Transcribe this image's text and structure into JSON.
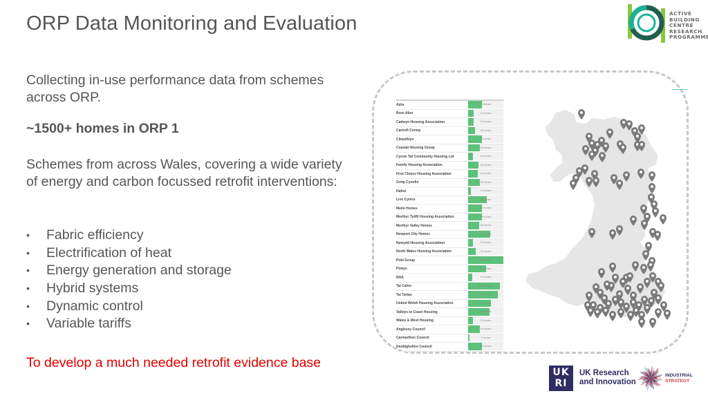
{
  "slide": {
    "title": "ORP Data Monitoring and Evaluation",
    "intro": "Collecting in-use performance data from schemes across ORP.",
    "highlight": "~1500+ homes in ORP 1",
    "schemes_text": "Schemes from across Wales, covering a wide variety of energy and carbon focussed retrofit interventions:",
    "bullet_glyph": "•",
    "interventions": [
      "Fabric efficiency",
      "Electrification of heat",
      "Energy generation and storage",
      "Hybrid systems",
      "Dynamic control",
      "Variable tariffs"
    ],
    "callout": "To develop a much needed retrofit evidence base",
    "callout_color": "#e00000"
  },
  "logos": {
    "abc": [
      "ACTIVE",
      "BUILDING",
      "CENTRE",
      "RESEARCH",
      "PROGRAMME"
    ],
    "ukri_letters": "UK\nRI",
    "ukri_name_line1": "UK Research",
    "ukri_name_line2": "and Innovation",
    "industrial_line1": "INDUSTRIAL",
    "industrial_line2": "STRATEGY"
  },
  "scheme_table": {
    "unit": "homes",
    "bar_color": "#5cc17a",
    "max_value": 150,
    "rows": [
      {
        "name": "Adra",
        "homes": 60
      },
      {
        "name": "Bron Afon",
        "homes": 23
      },
      {
        "name": "Cadwyn Housing Association",
        "homes": 24
      },
      {
        "name": "Cartrefi Conwy",
        "homes": 28
      },
      {
        "name": "ClwydAlyn",
        "homes": 58
      },
      {
        "name": "Coastal Housing Group",
        "homes": 50
      },
      {
        "name": "Cynon Taf Community Housing Ltd",
        "homes": 20
      },
      {
        "name": "Family Housing Association",
        "homes": 45
      },
      {
        "name": "First Choice Housing Association",
        "homes": 40
      },
      {
        "name": "Grŵp Cynefin",
        "homes": 50
      },
      {
        "name": "Hafod",
        "homes": 12
      },
      {
        "name": "Linc Cymru",
        "homes": 80
      },
      {
        "name": "Melin Homes",
        "homes": 60
      },
      {
        "name": "Merthyr Tydfil Housing Association",
        "homes": 60
      },
      {
        "name": "Merthyr Valley Homes",
        "homes": 46
      },
      {
        "name": "Newport City Homes",
        "homes": 95
      },
      {
        "name": "Newydd Housing Association",
        "homes": 21
      },
      {
        "name": "North Wales Housing Association",
        "homes": 31
      },
      {
        "name": "Pobl Group",
        "homes": 150
      },
      {
        "name": "Powys",
        "homes": 75
      },
      {
        "name": "RHA",
        "homes": 18
      },
      {
        "name": "Tai Calon",
        "homes": 135
      },
      {
        "name": "Tai Tarian",
        "homes": 125
      },
      {
        "name": "United Welsh Housing Association",
        "homes": 97
      },
      {
        "name": "Valleys to Coast Housing",
        "homes": 92
      },
      {
        "name": "Wales & West Housing",
        "homes": 20
      },
      {
        "name": "Anglesey Council",
        "homes": 49
      },
      {
        "name": "Carmarthen Council",
        "homes": 7
      },
      {
        "name": "Denbighshire Council",
        "homes": 60
      }
    ]
  },
  "map": {
    "region": "Wales",
    "land_color": "#e6e6e6",
    "pin_color": "#7a7a7a",
    "pin_count_note": "scheme locations"
  }
}
